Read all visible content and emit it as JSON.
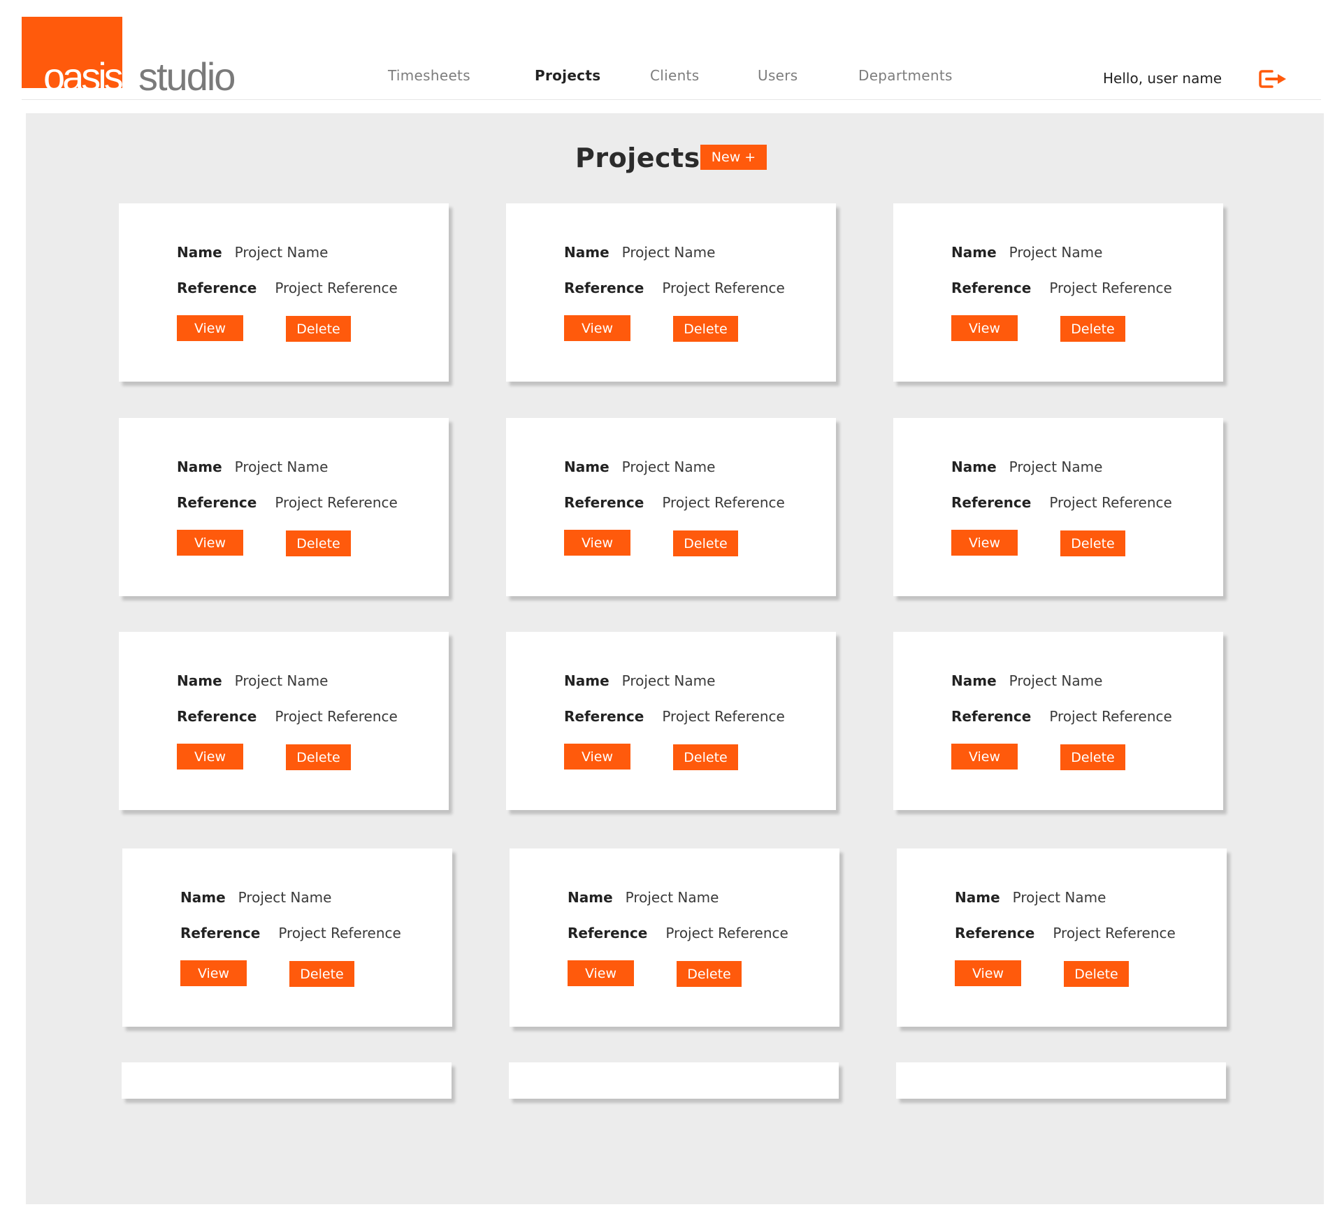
{
  "brand": {
    "word1": "oasis",
    "word2": "studio",
    "accent": "#ff5a0c"
  },
  "nav": {
    "items": [
      {
        "label": "Timesheets",
        "active": false
      },
      {
        "label": "Projects",
        "active": true
      },
      {
        "label": "Clients",
        "active": false
      },
      {
        "label": "Users",
        "active": false
      },
      {
        "label": "Departments",
        "active": false
      }
    ]
  },
  "user": {
    "greeting": "Hello, user name",
    "logout_icon": "logout-icon"
  },
  "page": {
    "title": "Projects",
    "new_label": "New +"
  },
  "projects": {
    "name_label": "Name",
    "reference_label": "Reference",
    "view_label": "View",
    "delete_label": "Delete",
    "cards": [
      {
        "name": "Project Name",
        "reference": "Project Reference"
      },
      {
        "name": "Project Name",
        "reference": "Project Reference"
      },
      {
        "name": "Project Name",
        "reference": "Project Reference"
      },
      {
        "name": "Project Name",
        "reference": "Project Reference"
      },
      {
        "name": "Project Name",
        "reference": "Project Reference"
      },
      {
        "name": "Project Name",
        "reference": "Project Reference"
      },
      {
        "name": "Project Name",
        "reference": "Project Reference"
      },
      {
        "name": "Project Name",
        "reference": "Project Reference"
      },
      {
        "name": "Project Name",
        "reference": "Project Reference"
      },
      {
        "name": "Project Name",
        "reference": "Project Reference"
      },
      {
        "name": "Project Name",
        "reference": "Project Reference"
      },
      {
        "name": "Project Name",
        "reference": "Project Reference"
      }
    ]
  }
}
